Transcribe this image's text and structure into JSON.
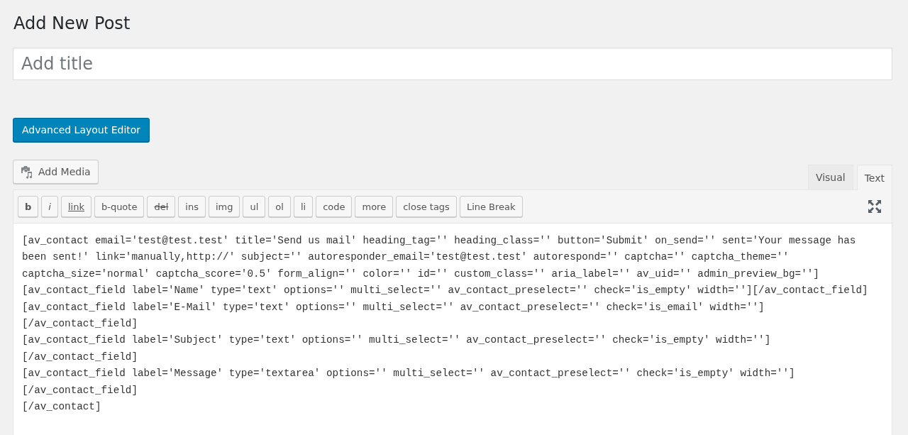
{
  "page_title": "Add New Post",
  "title_field": {
    "placeholder": "Add title"
  },
  "layout_button": "Advanced Layout Editor",
  "add_media_button": "Add Media",
  "editor_tabs": [
    {
      "label": "Visual",
      "selected": false
    },
    {
      "label": "Text",
      "selected": true
    }
  ],
  "quicktags": [
    {
      "label": "b",
      "kind": "bold"
    },
    {
      "label": "i",
      "kind": "italic"
    },
    {
      "label": "link",
      "kind": "link"
    },
    {
      "label": "b-quote",
      "kind": "plain"
    },
    {
      "label": "del",
      "kind": "strike"
    },
    {
      "label": "ins",
      "kind": "plain"
    },
    {
      "label": "img",
      "kind": "plain"
    },
    {
      "label": "ul",
      "kind": "plain"
    },
    {
      "label": "ol",
      "kind": "plain"
    },
    {
      "label": "li",
      "kind": "plain"
    },
    {
      "label": "code",
      "kind": "plain"
    },
    {
      "label": "more",
      "kind": "plain"
    },
    {
      "label": "close tags",
      "kind": "plain"
    },
    {
      "label": "Line Break",
      "kind": "plain"
    }
  ],
  "content_lines": [
    "[av_contact email='test@test.test' title='Send us mail' heading_tag='' heading_class='' button='Submit' on_send='' sent='Your message has",
    "been sent!' link='manually,http://' subject='' autoresponder_email='test@test.test' autorespond='' captcha='' captcha_theme=''",
    "captcha_size='normal' captcha_score='0.5' form_align='' color='' id='' custom_class='' aria_label='' av_uid='' admin_preview_bg='']",
    "[av_contact_field label='Name' type='text' options='' multi_select='' av_contact_preselect='' check='is_empty' width=''][/av_contact_field]",
    "[av_contact_field label='E-Mail' type='text' options='' multi_select='' av_contact_preselect='' check='is_email' width='']",
    "[/av_contact_field]",
    "[av_contact_field label='Subject' type='text' options='' multi_select='' av_contact_preselect='' check='is_empty' width='']",
    "[/av_contact_field]",
    "[av_contact_field label='Message' type='textarea' options='' multi_select='' av_contact_preselect='' check='is_empty' width='']",
    "[/av_contact_field]",
    "[/av_contact]"
  ]
}
